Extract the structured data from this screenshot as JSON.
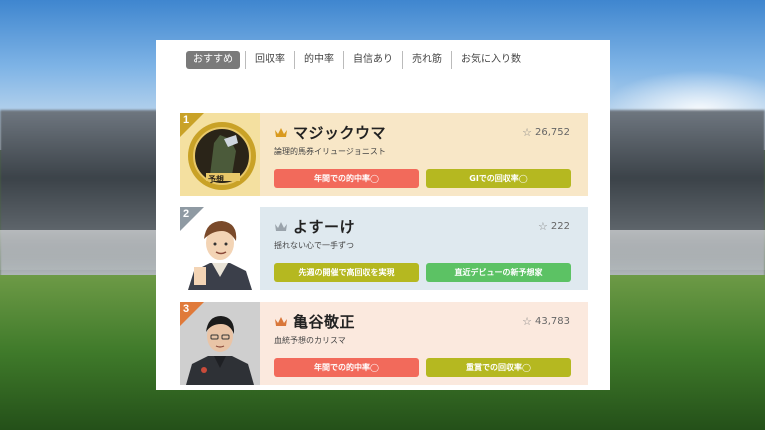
{
  "colors": {
    "tab_active_bg": "#7a7a7a",
    "badge_red": "#f26a5b",
    "badge_olive": "#b5b820",
    "badge_green": "#5cc264",
    "rank1": "#c9a227",
    "rank2": "#8f9aa3",
    "rank3": "#e07a3a"
  },
  "tabs": [
    {
      "label": "おすすめ",
      "active": true
    },
    {
      "label": "回収率",
      "active": false
    },
    {
      "label": "的中率",
      "active": false
    },
    {
      "label": "自信あり",
      "active": false
    },
    {
      "label": "売れ筋",
      "active": false
    },
    {
      "label": "お気に入り数",
      "active": false
    }
  ],
  "rankings": [
    {
      "rank": "1",
      "name": "マジックウマ",
      "favorites": "26,752",
      "subtitle": "論理的馬券イリュージョニスト",
      "badges": [
        "年間での的中率◯",
        "GIでの回収率◯"
      ],
      "crown_icon": "gold-crown-icon"
    },
    {
      "rank": "2",
      "name": "よすーけ",
      "favorites": "222",
      "subtitle": "揺れない心で一手ずつ",
      "badges": [
        "先週の開催で高回収を実現",
        "直近デビューの新予想家"
      ],
      "crown_icon": "silver-crown-icon"
    },
    {
      "rank": "3",
      "name": "亀谷敬正",
      "favorites": "43,783",
      "subtitle": "血統予想のカリスマ",
      "badges": [
        "年間での的中率◯",
        "重賞での回収率◯"
      ],
      "crown_icon": "bronze-crown-icon"
    }
  ],
  "star_icon": "☆"
}
